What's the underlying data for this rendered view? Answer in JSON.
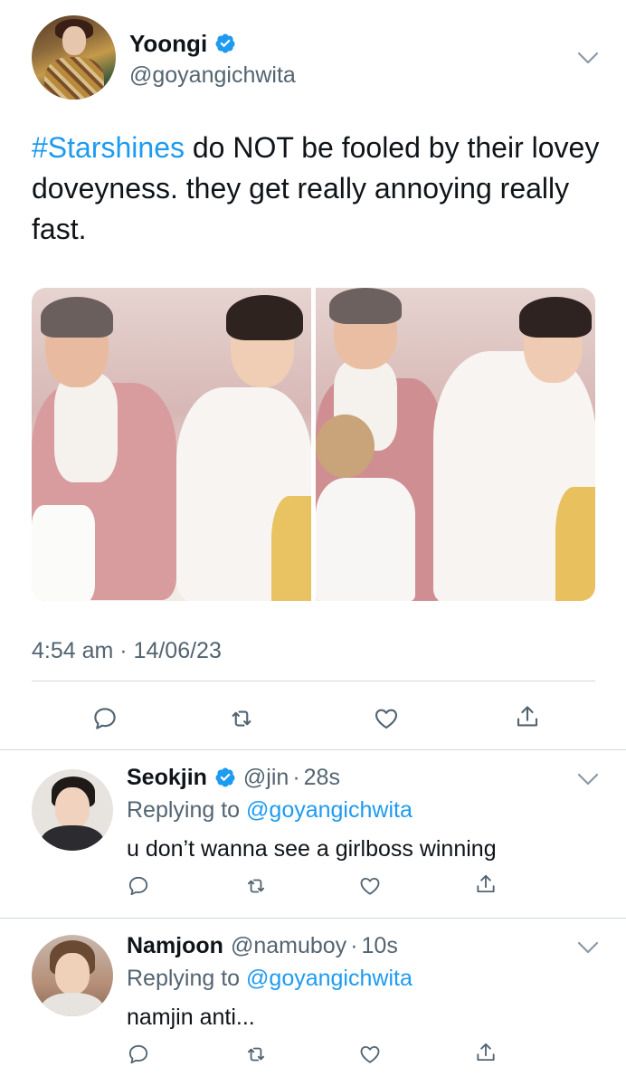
{
  "main_tweet": {
    "display_name": "Yoongi",
    "handle": "@goyangichwita",
    "hashtag": "#Starshines",
    "text": " do NOT be fooled by their lovey doveyness. they get really annoying really fast.",
    "timestamp": "4:54 am · 14/06/23",
    "actions": [
      "reply-icon",
      "retweet-icon",
      "like-icon",
      "share-icon"
    ]
  },
  "replies": [
    {
      "display_name": "Seokjin",
      "verified": true,
      "handle": "@jin",
      "dot": "·",
      "time": "28s",
      "replying_prefix": "Replying to ",
      "replying_to": "@goyangichwita",
      "text": "u don’t wanna see a girlboss winning"
    },
    {
      "display_name": "Namjoon",
      "verified": false,
      "handle": "@namuboy",
      "dot": "·",
      "time": "10s",
      "replying_prefix": "Replying to ",
      "replying_to": "@goyangichwita",
      "text": "namjin anti..."
    }
  ],
  "colors": {
    "accent": "#1d9bf0",
    "secondary_text": "#536471",
    "divider": "#cfd9de"
  }
}
